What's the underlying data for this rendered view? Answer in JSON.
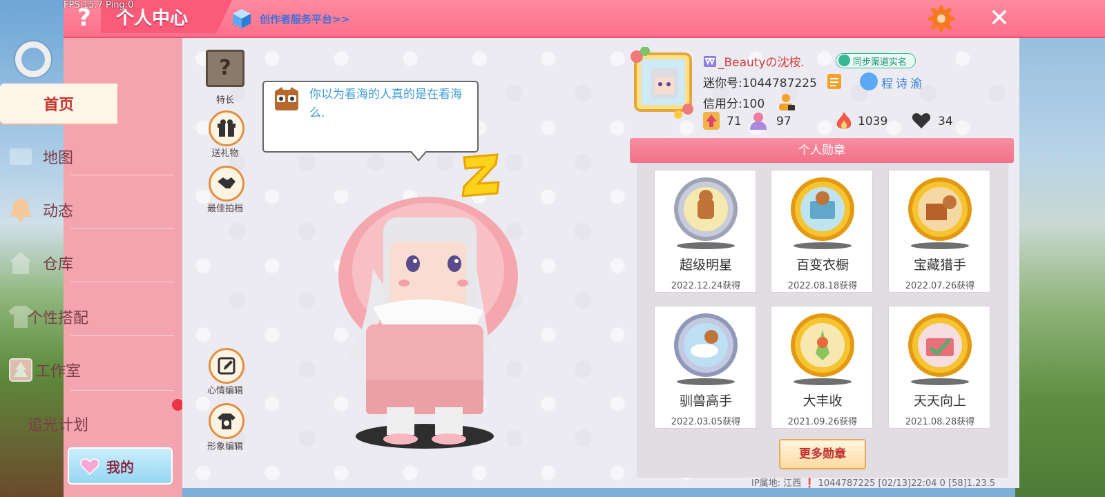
{
  "debug": {
    "fps_text": "FPS:15.7  Ping:0"
  },
  "header": {
    "title": "个人中心",
    "creator_link": "创作者服务平台>>",
    "help": "?",
    "close": "✕"
  },
  "sidebar": {
    "items": [
      {
        "label": "首页",
        "active": true
      },
      {
        "label": "地图"
      },
      {
        "label": "动态"
      },
      {
        "label": "仓库"
      },
      {
        "label": "个性搭配"
      },
      {
        "label": "工作室"
      },
      {
        "label": "追光计划"
      }
    ],
    "mine_label": "我的"
  },
  "actions": {
    "talent": "特长",
    "talent_mark": "?",
    "gift": "送礼物",
    "partner": "最佳拍档",
    "mood_edit": "心情编辑",
    "avatar_edit": "形象编辑"
  },
  "mood": {
    "text": "你以为看海的人真的是在看海么."
  },
  "profile": {
    "username": "_Beautyの沈桉.",
    "sync_badge": "同步渠道实名",
    "mini_id": "迷你号:1044787225",
    "friend_name": "程诗渝",
    "credit": "信用分:100",
    "stats": {
      "level": "71",
      "fans": "97",
      "heat": "1039",
      "likes": "34"
    }
  },
  "badges": {
    "header": "个人勋章",
    "items": [
      {
        "name": "超级明星",
        "date": "2022.12.24获得",
        "tier": "silver"
      },
      {
        "name": "百变衣橱",
        "date": "2022.08.18获得",
        "tier": "gold"
      },
      {
        "name": "宝藏猎手",
        "date": "2022.07.26获得",
        "tier": "gold"
      },
      {
        "name": "驯兽高手",
        "date": "2022.03.05获得",
        "tier": "silver"
      },
      {
        "name": "大丰收",
        "date": "2021.09.26获得",
        "tier": "gold"
      },
      {
        "name": "天天向上",
        "date": "2021.08.28获得",
        "tier": "gold"
      }
    ],
    "more_label": "更多勋章"
  },
  "footer": {
    "text": "IP属地: 江西 ❗      1044787225     [02/13]22:04 0  [58]1.23.5"
  },
  "colors": {
    "accent": "#ff6f8b",
    "sidebar": "#f4a4ae",
    "gold": "#f0b520",
    "silver": "#b8bdd0"
  }
}
